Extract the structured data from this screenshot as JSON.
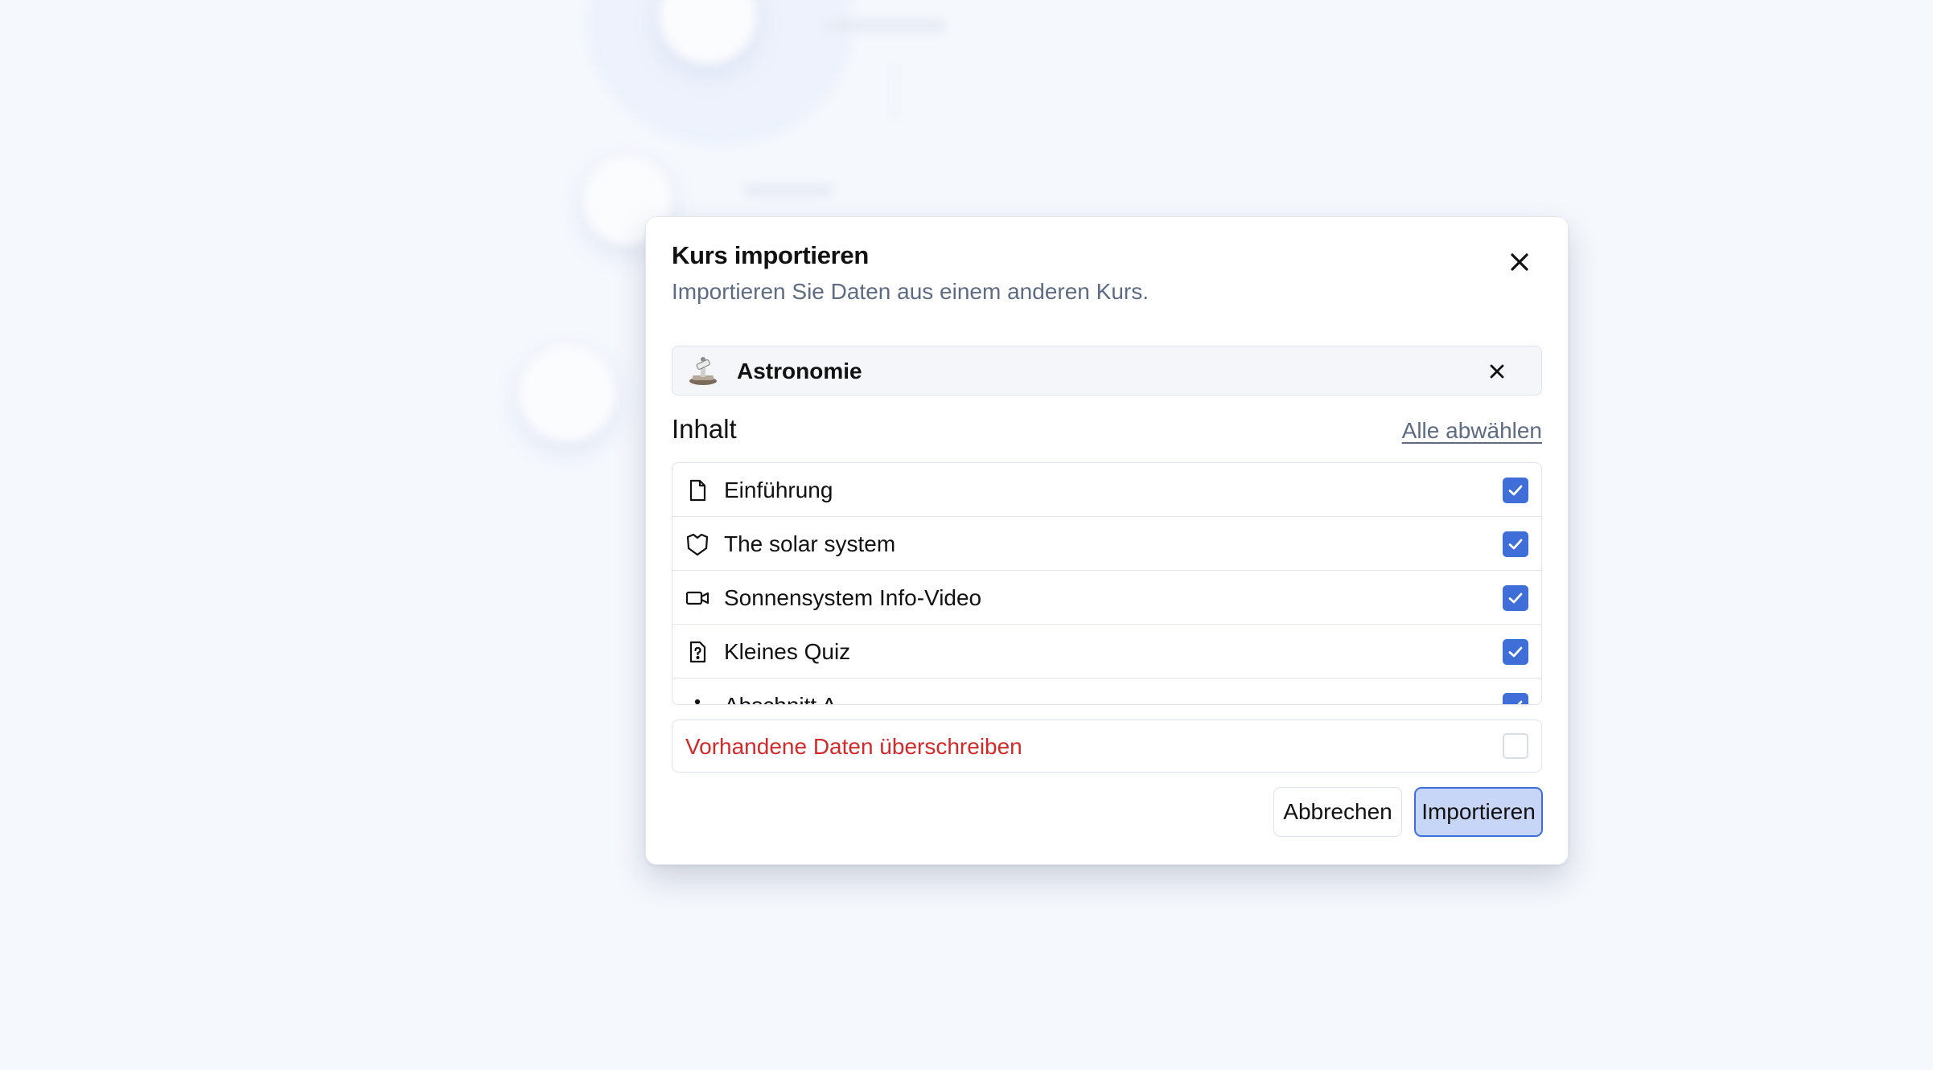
{
  "dialog": {
    "title": "Kurs importieren",
    "subtitle": "Importieren Sie Daten aus einem anderen Kurs.",
    "close_icon": "close-icon"
  },
  "selected_course": {
    "emoji_icon": "telescope-emoji",
    "name": "Astronomie",
    "clear_icon": "close-icon"
  },
  "content": {
    "label": "Inhalt",
    "deselect_all": "Alle abwählen",
    "items": [
      {
        "label": "Einführung",
        "icon": "document-icon",
        "checked": true
      },
      {
        "label": "The solar system",
        "icon": "map-icon",
        "checked": true
      },
      {
        "label": "Sonnensystem Info-Video",
        "icon": "video-icon",
        "checked": true
      },
      {
        "label": "Kleines Quiz",
        "icon": "quiz-file-icon",
        "checked": true
      },
      {
        "label": "Abschnitt A",
        "icon": "section-icon",
        "checked": true
      }
    ]
  },
  "overwrite": {
    "label": "Vorhandene Daten überschreiben",
    "checked": false
  },
  "actions": {
    "cancel": "Abbrechen",
    "import": "Importieren"
  },
  "colors": {
    "accent": "#3f6ed8",
    "danger": "#d2292b",
    "muted_text": "#5e6b82"
  }
}
